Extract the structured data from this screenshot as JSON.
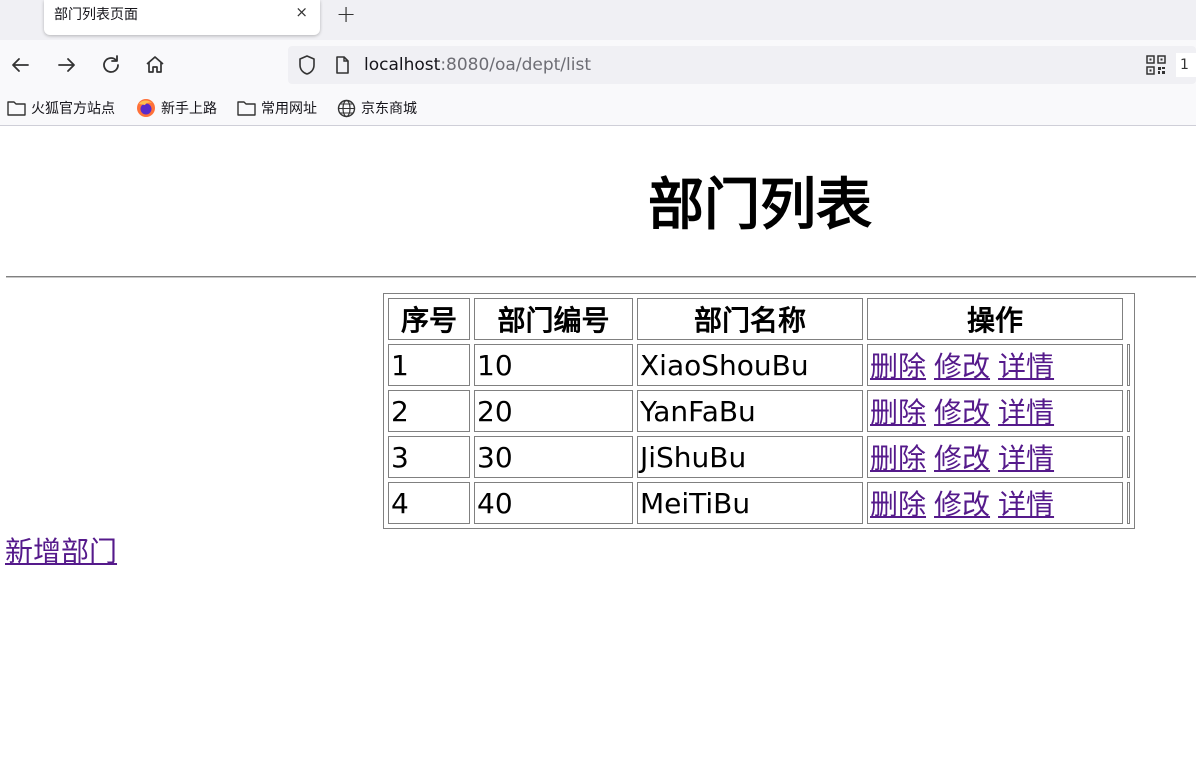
{
  "browser": {
    "tab_title": "部门列表页面",
    "tab_close": "×",
    "new_tab": "+",
    "url_host": "localhost",
    "url_path": ":8080/oa/dept/list",
    "url_extra": "1",
    "bookmarks": [
      {
        "label": "火狐官方站点",
        "icon": "folder-icon"
      },
      {
        "label": "新手上路",
        "icon": "firefox-icon"
      },
      {
        "label": "常用网址",
        "icon": "folder-icon"
      },
      {
        "label": "京东商城",
        "icon": "globe-icon"
      }
    ]
  },
  "page": {
    "title": "部门列表",
    "table": {
      "headers": [
        "序号",
        "部门编号",
        "部门名称",
        "操作"
      ],
      "rows": [
        {
          "seq": "1",
          "deptno": "10",
          "dname": "XiaoShouBu"
        },
        {
          "seq": "2",
          "deptno": "20",
          "dname": "YanFaBu"
        },
        {
          "seq": "3",
          "deptno": "30",
          "dname": "JiShuBu"
        },
        {
          "seq": "4",
          "deptno": "40",
          "dname": "MeiTiBu"
        }
      ],
      "actions": {
        "delete": "删除",
        "edit": "修改",
        "detail": "详情"
      }
    },
    "add_link": "新增部门",
    "link_color": "#551a8b"
  }
}
